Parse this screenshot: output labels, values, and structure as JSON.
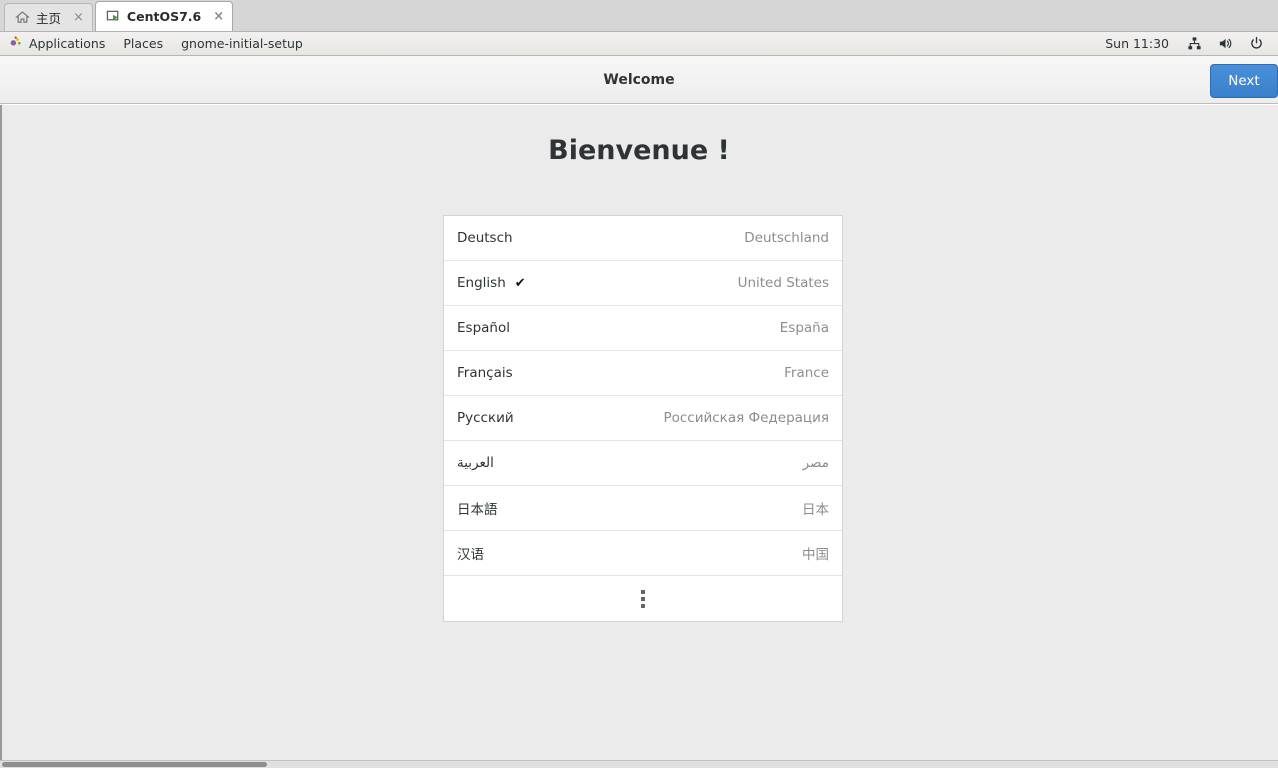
{
  "tabs": [
    {
      "label": "主页",
      "icon": "home-icon",
      "active": false,
      "close": "×"
    },
    {
      "label": "CentOS7.6",
      "icon": "vm-monitor-icon",
      "active": true,
      "close": "×"
    }
  ],
  "panel": {
    "applications_label": "Applications",
    "places_label": "Places",
    "window_label": "gnome-initial-setup",
    "clock": "Sun 11:30",
    "tray": [
      "network-icon",
      "volume-icon",
      "power-icon"
    ]
  },
  "headerbar": {
    "title": "Welcome",
    "next_label": "Next"
  },
  "main": {
    "welcome_title": "Bienvenue !",
    "languages": [
      {
        "name": "Deutsch",
        "country": "Deutschland",
        "selected": false,
        "rtl": false
      },
      {
        "name": "English",
        "country": "United States",
        "selected": true,
        "rtl": false
      },
      {
        "name": "Español",
        "country": "España",
        "selected": false,
        "rtl": false
      },
      {
        "name": "Français",
        "country": "France",
        "selected": false,
        "rtl": false
      },
      {
        "name": "Русский",
        "country": "Российская Федерация",
        "selected": false,
        "rtl": false
      },
      {
        "name": "العربية",
        "country": "مصر",
        "selected": false,
        "rtl": true
      },
      {
        "name": "日本語",
        "country": "日本",
        "selected": false,
        "rtl": false
      },
      {
        "name": "汉语",
        "country": "中国",
        "selected": false,
        "rtl": false
      }
    ],
    "more_label": "more-languages",
    "check_glyph": "✔"
  },
  "colors": {
    "accent_blue": "#3a7fca",
    "panel_bg": "#ebe9e6",
    "content_bg": "#ebebeb",
    "list_bg": "#ffffff",
    "text": "#2e3436",
    "muted_text": "#8d8d8d"
  }
}
